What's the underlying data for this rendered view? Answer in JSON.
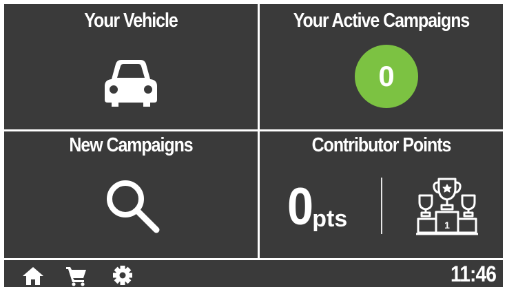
{
  "tiles": {
    "vehicle": {
      "title": "Your Vehicle",
      "icon": "car-icon"
    },
    "active_campaigns": {
      "title": "Your Active Campaigns",
      "count": "0",
      "badge_color": "#7cc242"
    },
    "new_campaigns": {
      "title": "New Campaigns",
      "icon": "search-icon"
    },
    "contributor_points": {
      "title": "Contributor Points",
      "value": "0",
      "unit": "pts",
      "icon": "trophy-podium-icon",
      "podium_rank": "1"
    }
  },
  "bottom_bar": {
    "icons": [
      "home-icon",
      "cart-icon",
      "gear-icon"
    ],
    "time": "11:46"
  },
  "colors": {
    "tile_background": "#3a3a3a",
    "text": "#ffffff",
    "accent": "#7cc242"
  }
}
